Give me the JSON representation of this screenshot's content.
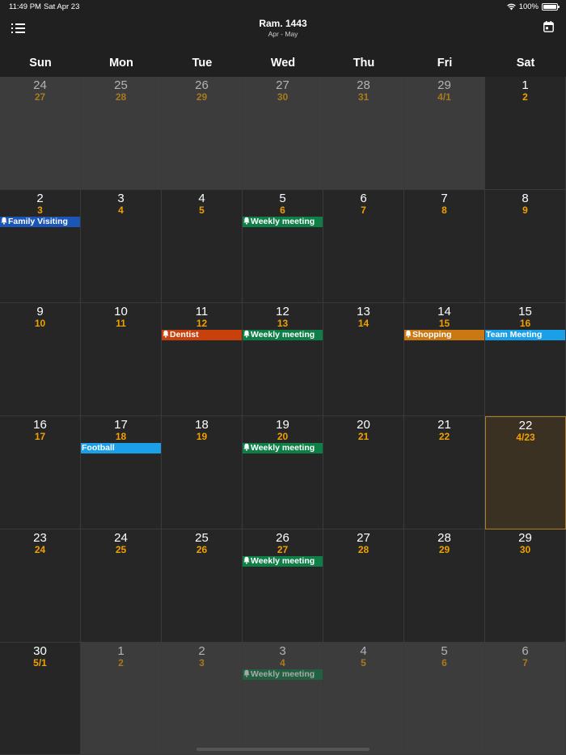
{
  "status_bar": {
    "time": "11:49 PM",
    "date": "Sat Apr 23",
    "battery": "100%"
  },
  "header": {
    "title": "Ram. 1443",
    "subtitle": "Apr - May"
  },
  "weekdays": [
    "Sun",
    "Mon",
    "Tue",
    "Wed",
    "Thu",
    "Fri",
    "Sat"
  ],
  "colors": {
    "blue": "#1b55b5",
    "green": "#0e7f47",
    "orange_red": "#c9400c",
    "orange": "#c97812",
    "cyan": "#1a9fe8",
    "hijri": "#f0a000",
    "today_border": "#b07f2a"
  },
  "weeks": [
    [
      {
        "g": "24",
        "h": "27",
        "other": true
      },
      {
        "g": "25",
        "h": "28",
        "other": true
      },
      {
        "g": "26",
        "h": "29",
        "other": true
      },
      {
        "g": "27",
        "h": "30",
        "other": true
      },
      {
        "g": "28",
        "h": "31",
        "other": true
      },
      {
        "g": "29",
        "h": "4/1",
        "other": true
      },
      {
        "g": "1",
        "h": "2",
        "other": false
      }
    ],
    [
      {
        "g": "2",
        "h": "3",
        "other": false,
        "event": {
          "label": "Family Visiting",
          "color": "blue",
          "bell": true
        }
      },
      {
        "g": "3",
        "h": "4",
        "other": false
      },
      {
        "g": "4",
        "h": "5",
        "other": false
      },
      {
        "g": "5",
        "h": "6",
        "other": false,
        "event": {
          "label": "Weekly meeting",
          "color": "green",
          "bell": true
        }
      },
      {
        "g": "6",
        "h": "7",
        "other": false
      },
      {
        "g": "7",
        "h": "8",
        "other": false
      },
      {
        "g": "8",
        "h": "9",
        "other": false
      }
    ],
    [
      {
        "g": "9",
        "h": "10",
        "other": false
      },
      {
        "g": "10",
        "h": "11",
        "other": false
      },
      {
        "g": "11",
        "h": "12",
        "other": false,
        "event": {
          "label": "Dentist",
          "color": "orange_red",
          "bell": true
        }
      },
      {
        "g": "12",
        "h": "13",
        "other": false,
        "event": {
          "label": "Weekly meeting",
          "color": "green",
          "bell": true
        }
      },
      {
        "g": "13",
        "h": "14",
        "other": false
      },
      {
        "g": "14",
        "h": "15",
        "other": false,
        "event": {
          "label": "Shopping",
          "color": "orange",
          "bell": true
        }
      },
      {
        "g": "15",
        "h": "16",
        "other": false,
        "event": {
          "label": "Team Meeting",
          "color": "cyan",
          "bell": false
        }
      }
    ],
    [
      {
        "g": "16",
        "h": "17",
        "other": false
      },
      {
        "g": "17",
        "h": "18",
        "other": false,
        "event": {
          "label": "Football",
          "color": "cyan",
          "bell": false
        }
      },
      {
        "g": "18",
        "h": "19",
        "other": false
      },
      {
        "g": "19",
        "h": "20",
        "other": false,
        "event": {
          "label": "Weekly meeting",
          "color": "green",
          "bell": true
        }
      },
      {
        "g": "20",
        "h": "21",
        "other": false
      },
      {
        "g": "21",
        "h": "22",
        "other": false
      },
      {
        "g": "22",
        "h": "4/23",
        "other": false,
        "today": true
      }
    ],
    [
      {
        "g": "23",
        "h": "24",
        "other": false
      },
      {
        "g": "24",
        "h": "25",
        "other": false
      },
      {
        "g": "25",
        "h": "26",
        "other": false
      },
      {
        "g": "26",
        "h": "27",
        "other": false,
        "event": {
          "label": "Weekly meeting",
          "color": "green",
          "bell": true
        }
      },
      {
        "g": "27",
        "h": "28",
        "other": false
      },
      {
        "g": "28",
        "h": "29",
        "other": false
      },
      {
        "g": "29",
        "h": "30",
        "other": false
      }
    ],
    [
      {
        "g": "30",
        "h": "5/1",
        "other": false
      },
      {
        "g": "1",
        "h": "2",
        "other": true
      },
      {
        "g": "2",
        "h": "3",
        "other": true
      },
      {
        "g": "3",
        "h": "4",
        "other": true,
        "event": {
          "label": "Weekly meeting",
          "color": "green",
          "bell": true
        }
      },
      {
        "g": "4",
        "h": "5",
        "other": true
      },
      {
        "g": "5",
        "h": "6",
        "other": true
      },
      {
        "g": "6",
        "h": "7",
        "other": true
      }
    ]
  ]
}
